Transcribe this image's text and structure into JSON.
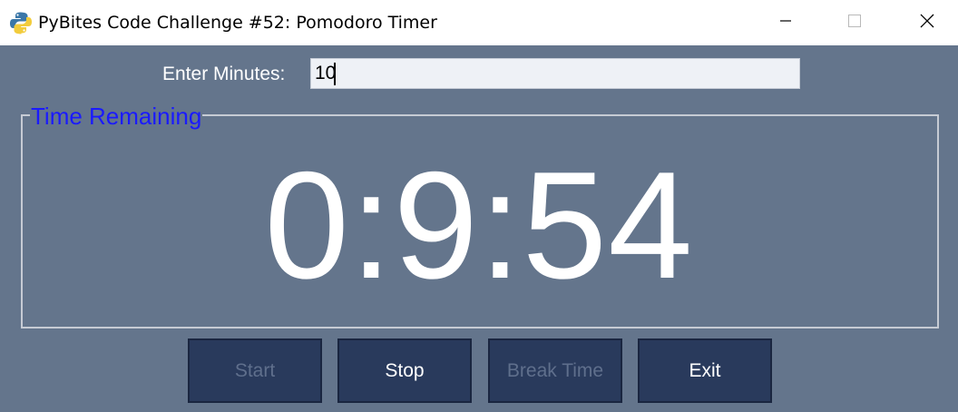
{
  "window": {
    "title": "PyBites Code Challenge #52: Pomodoro Timer",
    "icon": "python-logo-icon",
    "controls": [
      "minimize-icon",
      "maximize-icon",
      "close-icon"
    ]
  },
  "form": {
    "minutes_label": "Enter Minutes:",
    "minutes_value": "10"
  },
  "timer": {
    "frame_title": "Time Remaining",
    "display": "0:9:54"
  },
  "buttons": {
    "start": {
      "label": "Start",
      "enabled": false
    },
    "stop": {
      "label": "Stop",
      "enabled": true
    },
    "break_time": {
      "label": "Break Time",
      "enabled": false
    },
    "exit": {
      "label": "Exit",
      "enabled": true
    }
  },
  "colors": {
    "background": "#64758c",
    "button": "#293a5c",
    "legend_text": "#1a1aff",
    "disabled_text": "#5f6f8c"
  }
}
